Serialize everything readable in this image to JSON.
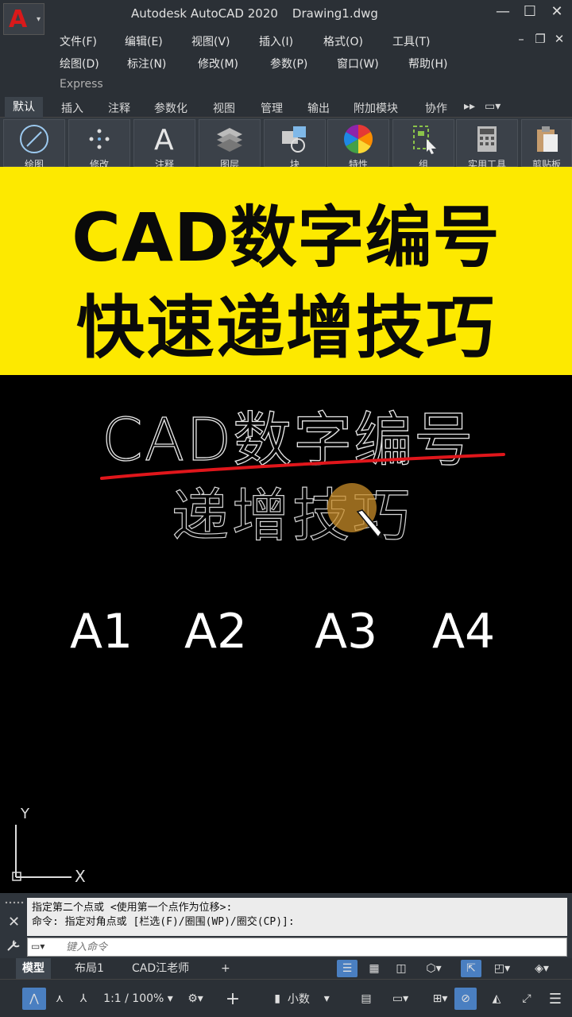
{
  "window": {
    "app_title": "Autodesk AutoCAD 2020",
    "doc_title": "Drawing1.dwg",
    "app_logo_letter": "A"
  },
  "menu": {
    "row1": [
      "文件(F)",
      "编辑(E)",
      "视图(V)",
      "插入(I)",
      "格式(O)",
      "工具(T)"
    ],
    "row2": [
      "绘图(D)",
      "标注(N)",
      "修改(M)",
      "参数(P)",
      "窗口(W)",
      "帮助(H)"
    ],
    "row3": [
      "Express"
    ]
  },
  "ribbon": {
    "tabs": [
      "默认",
      "插入",
      "注释",
      "参数化",
      "视图",
      "管理",
      "输出",
      "附加模块",
      "协作"
    ],
    "panels": [
      "绘图",
      "修改",
      "注释",
      "图层",
      "块",
      "特性",
      "组",
      "实用工具",
      "剪贴板"
    ]
  },
  "banner": {
    "line1": "CAD数字编号",
    "line2": "快速递增技巧",
    "bg_color": "#fde900"
  },
  "drawing": {
    "title_text": "CAD数字编号",
    "subtitle_text": "递增技巧",
    "labels": [
      "A1",
      "A2",
      "A3",
      "A4"
    ],
    "ucs_y": "Y",
    "ucs_x": "X",
    "underline_color": "#e0161b"
  },
  "command": {
    "history": [
      "指定第二个点或 <使用第一个点作为位移>:",
      "命令: 指定对角点或 [栏选(F)/圈围(WP)/圈交(CP)]:"
    ],
    "placeholder": "键入命令"
  },
  "layout_tabs": [
    "模型",
    "布局1",
    "CAD江老师"
  ],
  "status_bar": {
    "scale": "1:1 / 100%",
    "units": "小数"
  }
}
